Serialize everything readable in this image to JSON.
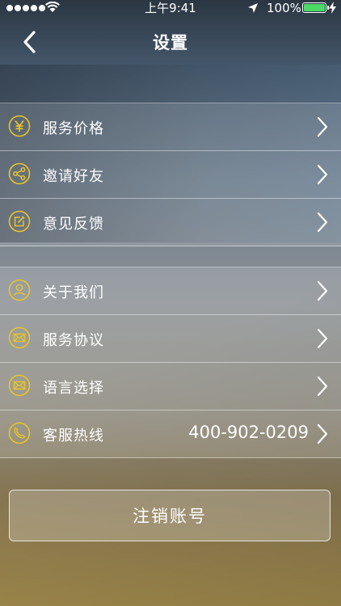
{
  "status_bar": {
    "time": "上午9:41",
    "battery_percent": "100%",
    "battery_level": 1.0,
    "signal_bars": 5
  },
  "nav": {
    "title": "设置",
    "back_icon": "chevron-left-icon"
  },
  "menu": {
    "group1": [
      {
        "label": "服务价格",
        "icon": "yen-icon"
      },
      {
        "label": "邀请好友",
        "icon": "share-icon"
      },
      {
        "label": "意见反馈",
        "icon": "edit-icon"
      }
    ],
    "group2": [
      {
        "label": "关于我们",
        "icon": "user-icon"
      },
      {
        "label": "服务协议",
        "icon": "mail-icon"
      },
      {
        "label": "语言选择",
        "icon": "mail-icon"
      },
      {
        "label": "客服热线",
        "icon": "phone-icon",
        "value": "400-902-0209"
      }
    ]
  },
  "logout": {
    "label": "注销账号"
  },
  "colors": {
    "icon_accent": "#e8c42a",
    "battery_green": "#4cd964",
    "text": "#ffffff"
  }
}
